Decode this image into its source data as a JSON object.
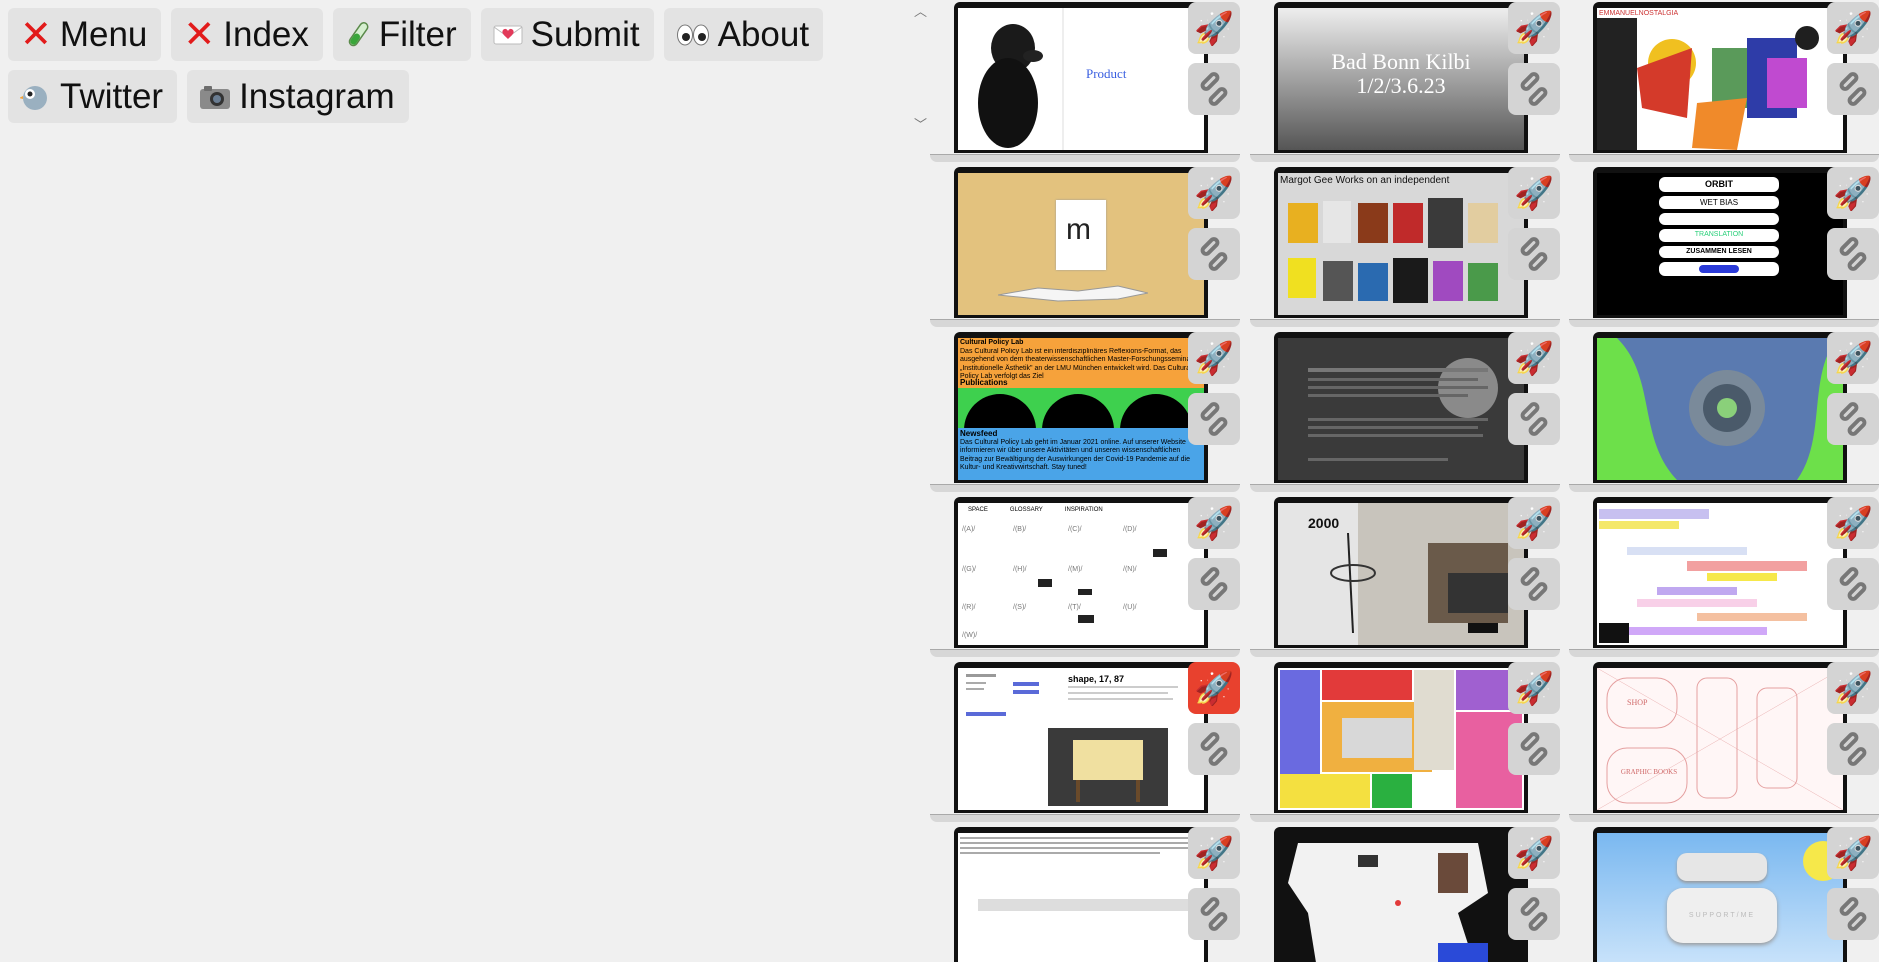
{
  "nav": [
    {
      "label": "Menu",
      "icon": "x-icon"
    },
    {
      "label": "Index",
      "icon": "x-icon"
    },
    {
      "label": "Filter",
      "icon": "test-tube-icon"
    },
    {
      "label": "Submit",
      "icon": "love-letter-icon"
    },
    {
      "label": "About",
      "icon": "eyes-icon"
    },
    {
      "label": "Twitter",
      "icon": "bird-icon"
    },
    {
      "label": "Instagram",
      "icon": "camera-icon"
    }
  ],
  "tiles": {
    "t1": {
      "text": "Product"
    },
    "t2": {
      "line1": "Bad Bonn Kilbi",
      "line2": "1/2/3.6.23"
    },
    "t3": {
      "text": "EMMANUELNOSTALGIA"
    },
    "t4": {
      "letter": "m"
    },
    "t5": {
      "text": "Margot Gee Works on an independent"
    },
    "t6": {
      "items": [
        "ORBIT",
        "WET BIAS",
        "TRANSLATION",
        "ZUSAMMEN LESEN"
      ]
    },
    "t7": {
      "heading": "Cultural Policy Lab",
      "body": "Das Cultural Policy Lab ist ein interdisziplinäres Reflexions-Format, das ausgehend von dem theaterwissenschaftlichen Master-Forschungsseminar „Institutionelle Ästhetik\" an der LMU München entwickelt wird. Das Cultural Policy Lab verfolgt das Ziel",
      "publications": "Publications",
      "newsfeed": "Newsfeed",
      "news_body": "Das Cultural Policy Lab geht im Januar 2021 online. Auf unserer Website informieren wir über unsere Aktivitäten und unseren wissenschaftlichen Beitrag zur Bewältigung der Auswirkungen der Covid-19 Pandemie auf die Kultur- und Kreativwirtschaft. Stay tuned!"
    },
    "t10": {
      "labels": [
        "SPACE",
        "GLOSSARY",
        "INSPIRATION"
      ]
    },
    "t11": {
      "year": "2000"
    },
    "t13": {
      "title": "shape, 17, 87"
    },
    "t15": {
      "labels": [
        "SHOP",
        "GRAPHIC BOOKS"
      ]
    },
    "t18": {
      "label": "SUPPORT/ME"
    }
  },
  "colors": {
    "nav_bg": "#e3e3e3",
    "page_bg": "#f0f0f0",
    "ctrl_bg": "#d4d4d4",
    "ctrl_active": "#e8412e",
    "cpl_orange": "#f6a23b",
    "cpl_green": "#3ed04e",
    "cpl_blue": "#4aa4e8"
  }
}
